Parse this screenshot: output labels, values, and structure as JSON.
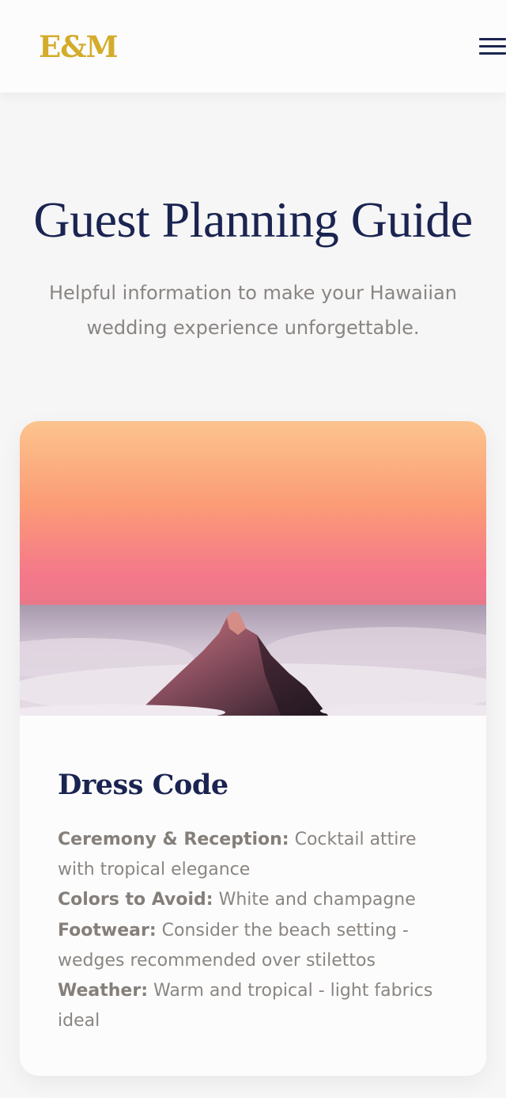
{
  "header": {
    "logo": "E&M",
    "menu_icon": "hamburger-menu-icon"
  },
  "hero": {
    "title": "Guest Planning Guide",
    "subtitle": "Helpful information to make your Hawaiian wedding experience unforgettable."
  },
  "card": {
    "image_subject": "mountain-peak-at-sunset",
    "title": "Dress Code",
    "items": [
      {
        "label": "Ceremony & Reception:",
        "text": "Cocktail attire with tropical elegance"
      },
      {
        "label": "Colors to Avoid:",
        "text": "White and champagne"
      },
      {
        "label": "Footwear:",
        "text": "Consider the beach setting - wedges recommended over stilettos"
      },
      {
        "label": "Weather:",
        "text": "Warm and tropical - light fabrics ideal"
      }
    ]
  },
  "colors": {
    "brand_gold": "#d4ac2b",
    "navy": "#1b2451",
    "body_text": "#8a8581",
    "background": "#f6f6f7"
  }
}
